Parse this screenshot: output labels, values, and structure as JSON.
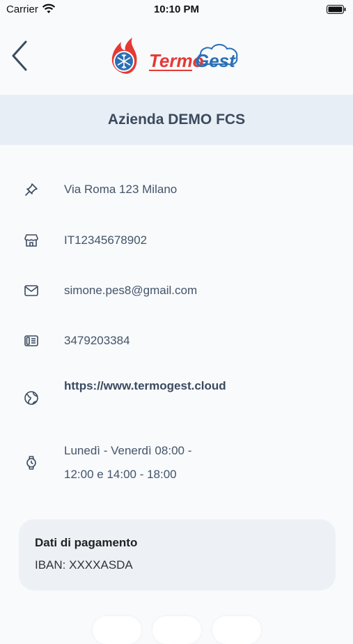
{
  "status_bar": {
    "carrier": "Carrier",
    "time": "10:10 PM"
  },
  "header": {
    "logo_text_part1": "Termo",
    "logo_text_part2": "Gest"
  },
  "company": {
    "name": "Azienda DEMO FCS"
  },
  "details": {
    "address": "Via Roma 123 Milano",
    "vat": "IT12345678902",
    "email": "simone.pes8@gmail.com",
    "phone": "3479203384",
    "website": "https://www.termogest.cloud",
    "hours": "Lunedì - Venerdì 08:00 - 12:00 e 14:00 - 18:00"
  },
  "payment": {
    "title": "Dati di pagamento",
    "iban": "IBAN: XXXXASDA"
  },
  "colors": {
    "accent_red": "#e53935",
    "accent_blue": "#2a6fb5",
    "text": "#3b4a5e",
    "band": "#e8eef5"
  }
}
